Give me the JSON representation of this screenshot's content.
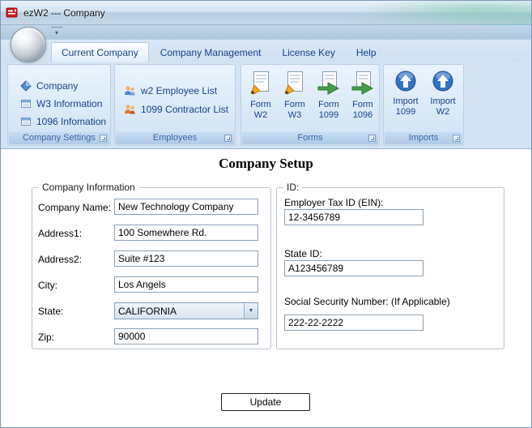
{
  "window": {
    "title": "ezW2 --- Company"
  },
  "ribbon": {
    "tabs": [
      {
        "label": "Current Company",
        "active": true
      },
      {
        "label": "Company Management",
        "active": false
      },
      {
        "label": "License Key",
        "active": false
      },
      {
        "label": "Help",
        "active": false
      }
    ],
    "groups": [
      {
        "label": "Company Settings",
        "items": [
          {
            "label": "Company"
          },
          {
            "label": "W3 Information"
          },
          {
            "label": "1096 Infomation"
          }
        ]
      },
      {
        "label": "Employees",
        "items": [
          {
            "label": "w2 Employee List"
          },
          {
            "label": "1099 Contractor List"
          }
        ]
      },
      {
        "label": "Forms",
        "items": [
          {
            "line1": "Form",
            "line2": "W2"
          },
          {
            "line1": "Form",
            "line2": "W3"
          },
          {
            "line1": "Form",
            "line2": "1099"
          },
          {
            "line1": "Form",
            "line2": "1096"
          }
        ]
      },
      {
        "label": "Imports",
        "items": [
          {
            "line1": "Import",
            "line2": "1099"
          },
          {
            "line1": "Import",
            "line2": "W2"
          }
        ]
      }
    ]
  },
  "main": {
    "title": "Company Setup",
    "company_info": {
      "legend": "Company Information",
      "fields": [
        {
          "label": "Company Name:",
          "value": "New Technology Company"
        },
        {
          "label": "Address1:",
          "value": "100 Somewhere Rd."
        },
        {
          "label": "Address2:",
          "value": "Suite #123"
        },
        {
          "label": "City:",
          "value": "Los Angels"
        },
        {
          "label": "State:",
          "value": "CALIFORNIA"
        },
        {
          "label": "Zip:",
          "value": "90000"
        }
      ]
    },
    "id_info": {
      "legend": "ID:",
      "fields": [
        {
          "label": "Employer Tax ID (EIN):",
          "value": "12-3456789"
        },
        {
          "label": "State ID:",
          "value": "A123456789"
        },
        {
          "label": "Social Security Number: (If Applicable)",
          "value": "222-22-2222"
        }
      ]
    },
    "update_button": "Update"
  },
  "icons": {
    "qat_dropdown": "▾",
    "combo_arrow": "▼"
  },
  "colors": {
    "accent_blue": "#15428b",
    "ribbon_bg": "#d3e3f3",
    "caption_text": "#3a66a8"
  }
}
